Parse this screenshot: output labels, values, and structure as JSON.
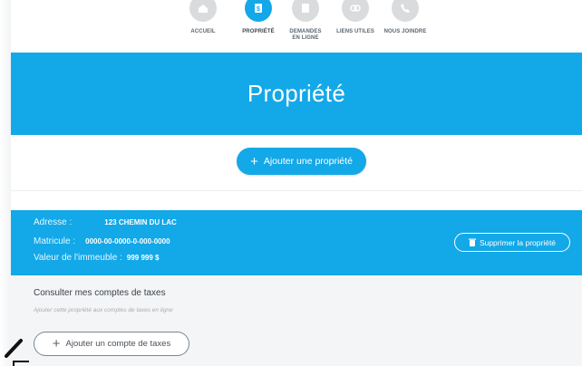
{
  "nav": {
    "items": [
      {
        "label": "ACCUEIL",
        "icon": "home-icon",
        "active": false
      },
      {
        "label": "PROPRIÉTÉ",
        "icon": "dollar-icon",
        "active": true
      },
      {
        "label": "DEMANDES EN LIGNE",
        "icon": "document-icon",
        "active": false
      },
      {
        "label": "LIENS UTILES",
        "icon": "link-icon",
        "active": false
      },
      {
        "label": "NOUS JOINDRE",
        "icon": "phone-icon",
        "active": false
      }
    ]
  },
  "banner": {
    "title": "Propriété"
  },
  "actions": {
    "add_property": "Ajouter une propriété"
  },
  "property": {
    "address_label": "Adresse :",
    "address_value": "123 CHEMIN DU LAC",
    "matricule_label": "Matricule :",
    "matricule_value": "0000-00-0000-0-000-0000",
    "value_label": "Valeur de l'immeuble :",
    "value_value": "999 999 $",
    "delete_label": "Supprimer la propriété"
  },
  "taxes": {
    "title": "Consulter mes comptes de taxes",
    "hint": "Ajouter cette propriété aux comptes de taxes en ligne",
    "add_label": "Ajouter un compte de taxes"
  },
  "colors": {
    "accent": "#13a8e8",
    "nav_inactive": "#d9dbdd",
    "panel": "#f4f5f6"
  }
}
